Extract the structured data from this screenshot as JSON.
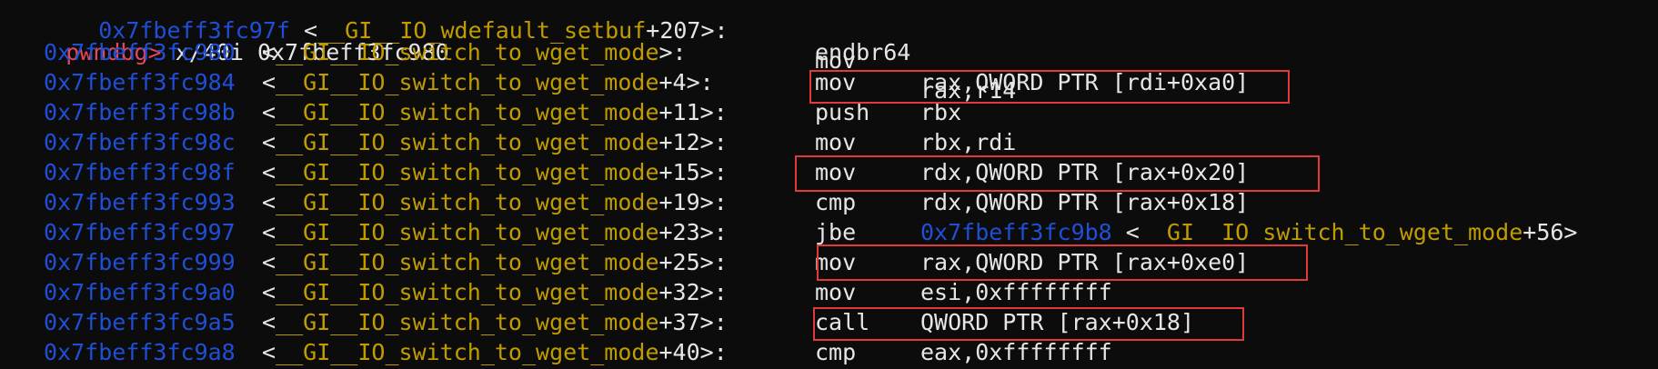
{
  "terminal": {
    "partial_top": {
      "addr": "0x7fbeff3fc97f",
      "sym": "__GI__IO_wdefault_setbuf",
      "off": "+207",
      "mnemonic": "mov",
      "operands": "rax,r14"
    },
    "prompt": "pwndbg>",
    "command": "x/40i 0x7fbeff3fc980",
    "lines": [
      {
        "addr": "0x7fbeff3fc980",
        "sym": "__GI__IO_switch_to_wget_mode",
        "off": "",
        "mnemonic": "endbr64",
        "operands": ""
      },
      {
        "addr": "0x7fbeff3fc984",
        "sym": "__GI__IO_switch_to_wget_mode",
        "off": "+4",
        "mnemonic": "mov",
        "operands": "rax,QWORD PTR [rdi+0xa0]"
      },
      {
        "addr": "0x7fbeff3fc98b",
        "sym": "__GI__IO_switch_to_wget_mode",
        "off": "+11",
        "mnemonic": "push",
        "operands": "rbx"
      },
      {
        "addr": "0x7fbeff3fc98c",
        "sym": "__GI__IO_switch_to_wget_mode",
        "off": "+12",
        "mnemonic": "mov",
        "operands": "rbx,rdi"
      },
      {
        "addr": "0x7fbeff3fc98f",
        "sym": "__GI__IO_switch_to_wget_mode",
        "off": "+15",
        "mnemonic": "mov",
        "operands": "rdx,QWORD PTR [rax+0x20]"
      },
      {
        "addr": "0x7fbeff3fc993",
        "sym": "__GI__IO_switch_to_wget_mode",
        "off": "+19",
        "mnemonic": "cmp",
        "operands": "rdx,QWORD PTR [rax+0x18]"
      },
      {
        "addr": "0x7fbeff3fc997",
        "sym": "__GI__IO_switch_to_wget_mode",
        "off": "+23",
        "mnemonic": "jbe",
        "operands": "",
        "target_addr": "0x7fbeff3fc9b8",
        "target_sym": "__GI__IO_switch_to_wget_mode",
        "target_off": "+56"
      },
      {
        "addr": "0x7fbeff3fc999",
        "sym": "__GI__IO_switch_to_wget_mode",
        "off": "+25",
        "mnemonic": "mov",
        "operands": "rax,QWORD PTR [rax+0xe0]"
      },
      {
        "addr": "0x7fbeff3fc9a0",
        "sym": "__GI__IO_switch_to_wget_mode",
        "off": "+32",
        "mnemonic": "mov",
        "operands": "esi,0xffffffff"
      },
      {
        "addr": "0x7fbeff3fc9a5",
        "sym": "__GI__IO_switch_to_wget_mode",
        "off": "+37",
        "mnemonic": "call",
        "operands": "QWORD PTR [rax+0x18]"
      },
      {
        "addr": "0x7fbeff3fc9a8",
        "sym": "__GI__IO_switch_to_wget_mode",
        "off": "+40",
        "mnemonic": "cmp",
        "operands": "eax,0xffffffff"
      }
    ],
    "colors": {
      "background": "#0c0c0c",
      "address": "#1f4fd6",
      "symbol": "#c19c00",
      "prompt": "#e74856",
      "highlight_box": "#e03a3a",
      "text": "#e6e6e6"
    }
  }
}
